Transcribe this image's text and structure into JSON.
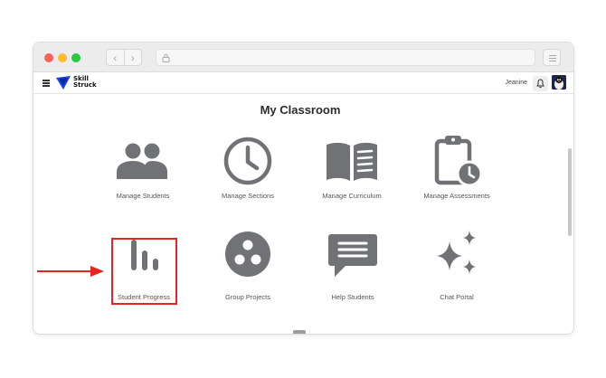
{
  "header": {
    "brand_line1": "Skill",
    "brand_line2": "Struck",
    "username": "Jeanine"
  },
  "page": {
    "title": "My Classroom"
  },
  "tiles": [
    {
      "label": "Manage Students",
      "icon": "people-icon"
    },
    {
      "label": "Manage Sections",
      "icon": "clock-icon"
    },
    {
      "label": "Manage Curriculum",
      "icon": "open-book-icon"
    },
    {
      "label": "Manage Assessments",
      "icon": "clipboard-clock-icon"
    },
    {
      "label": "Student Progress",
      "icon": "bar-chart-icon"
    },
    {
      "label": "Group Projects",
      "icon": "circle-dots-icon"
    },
    {
      "label": "Help Students",
      "icon": "chat-bubble-icon"
    },
    {
      "label": "Chat Portal",
      "icon": "sparkles-icon"
    }
  ],
  "colors": {
    "icon": "#707275",
    "highlight": "#e8241e",
    "brand": "#1a43e6"
  }
}
